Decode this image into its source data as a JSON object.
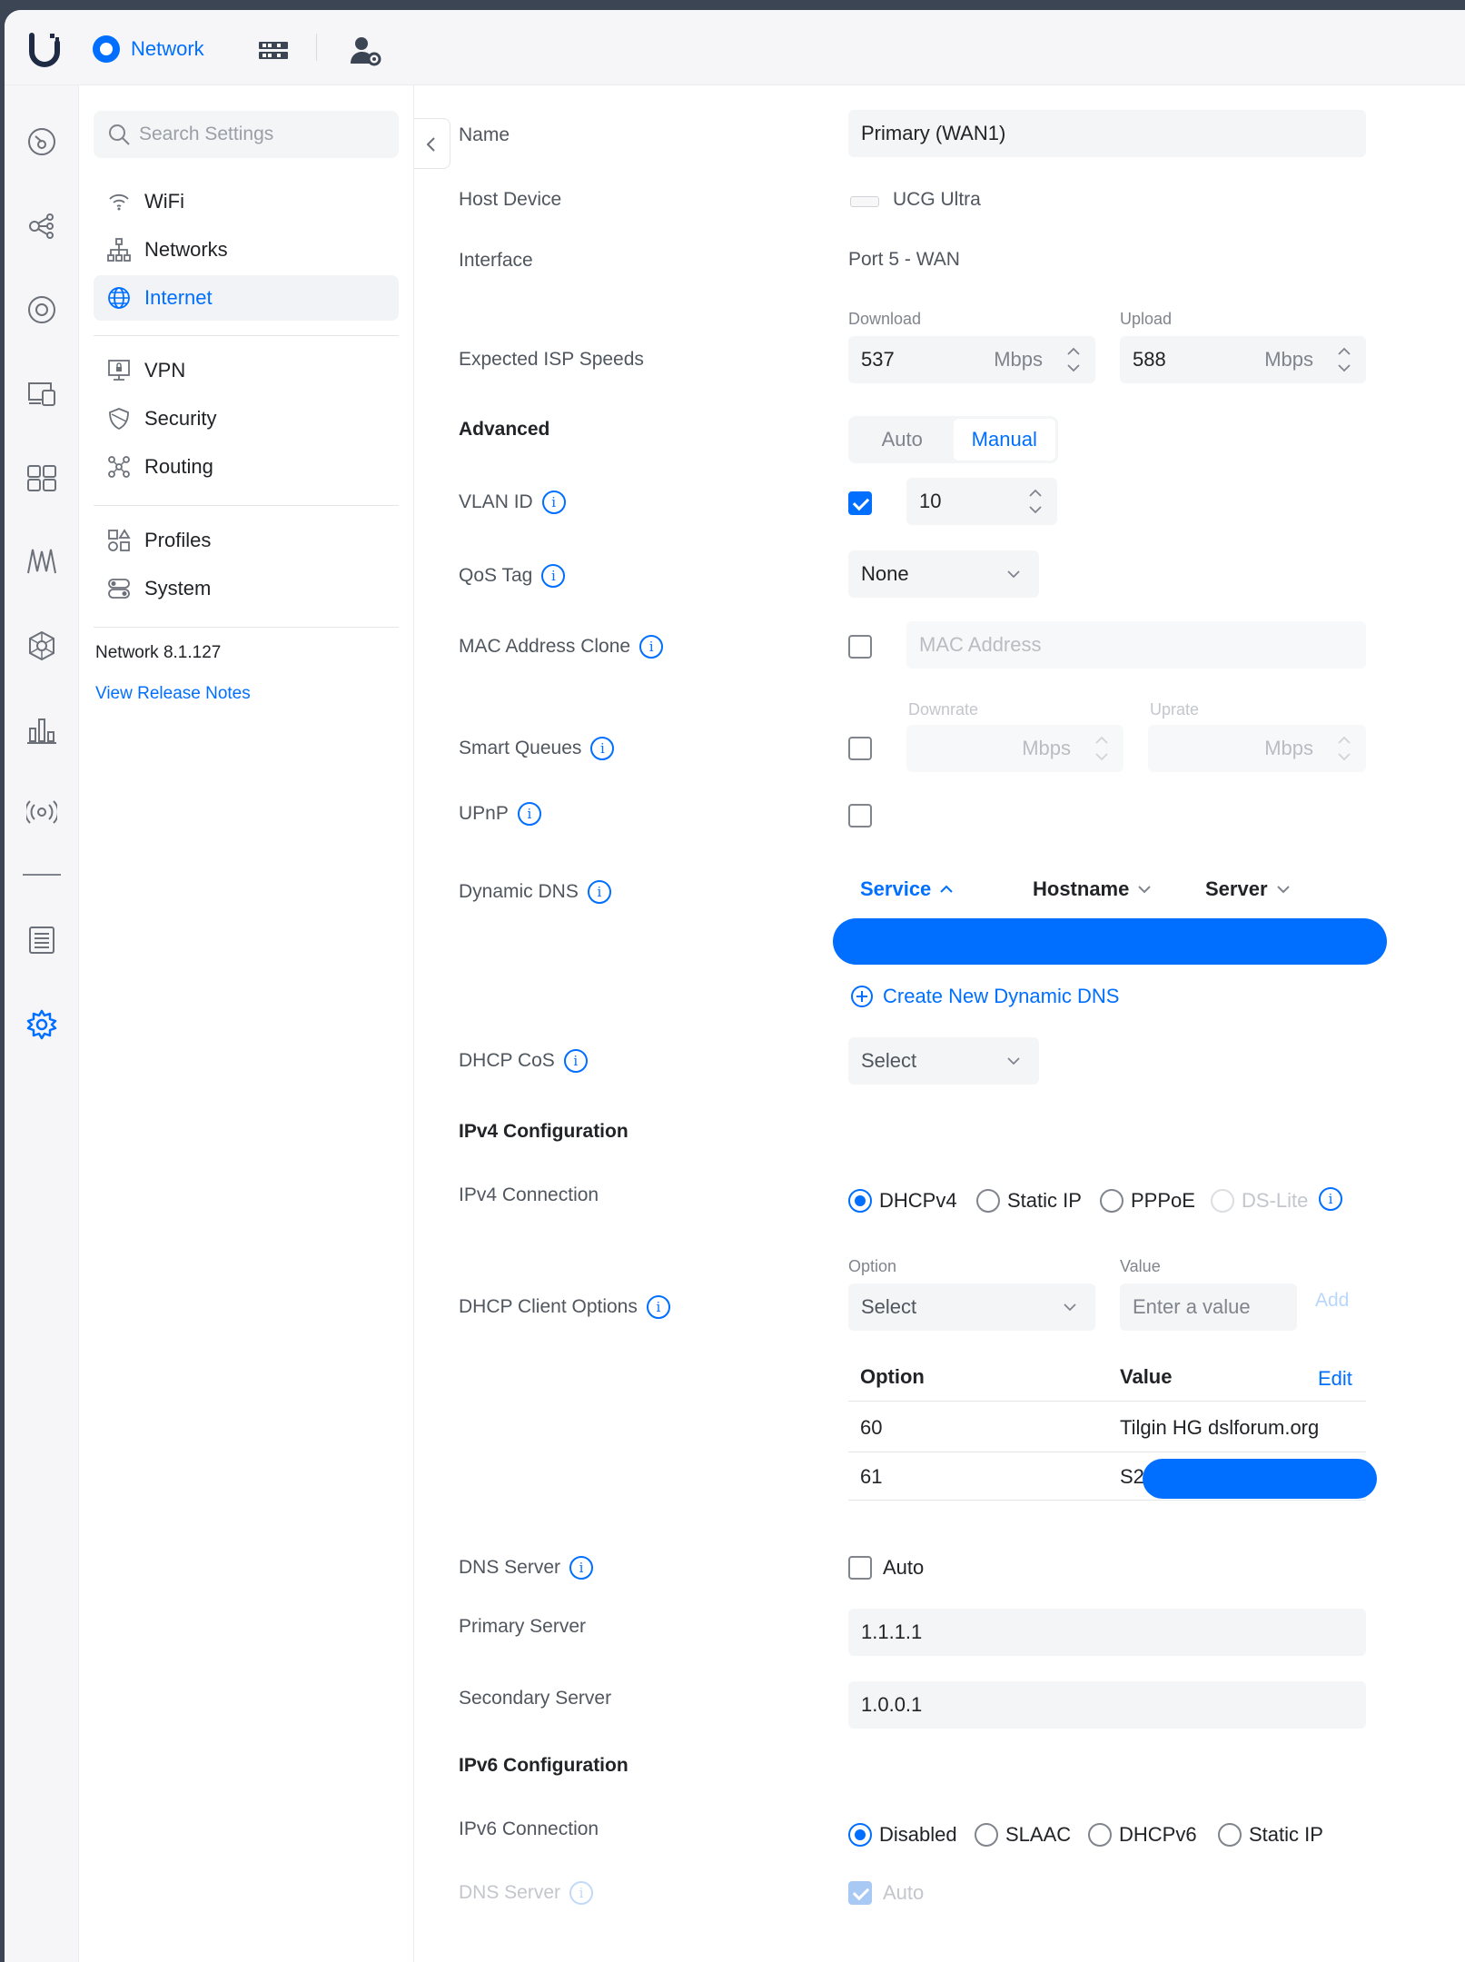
{
  "topbar": {
    "app_name": "Network",
    "icons": [
      "ubiquiti-logo-icon",
      "network-app-icon",
      "dashboard-grid-icon",
      "user-settings-icon"
    ]
  },
  "rail": {
    "icons": [
      "dashboard-icon",
      "topology-icon",
      "ubiquiti-devices-icon",
      "client-devices-icon",
      "ports-icon",
      "insights-icon",
      "integrations-icon",
      "statistics-icon",
      "radio-icon",
      "logs-icon",
      "settings-icon"
    ]
  },
  "nav": {
    "search_placeholder": "Search Settings",
    "items": [
      {
        "label": "WiFi",
        "icon": "wifi-icon"
      },
      {
        "label": "Networks",
        "icon": "networks-icon"
      },
      {
        "label": "Internet",
        "icon": "globe-icon",
        "active": true
      },
      {
        "label": "VPN",
        "icon": "vpn-icon"
      },
      {
        "label": "Security",
        "icon": "shield-icon"
      },
      {
        "label": "Routing",
        "icon": "routing-icon"
      },
      {
        "label": "Profiles",
        "icon": "profiles-icon"
      },
      {
        "label": "System",
        "icon": "system-icon"
      }
    ],
    "version": "Network 8.1.127",
    "release_notes": "View Release Notes"
  },
  "form": {
    "name": {
      "label": "Name",
      "value": "Primary (WAN1)"
    },
    "host_device": {
      "label": "Host Device",
      "value": "UCG Ultra"
    },
    "interface": {
      "label": "Interface",
      "value": "Port 5 - WAN"
    },
    "isp_speeds": {
      "label": "Expected ISP Speeds",
      "download_label": "Download",
      "download_value": "537",
      "upload_label": "Upload",
      "upload_value": "588",
      "unit": "Mbps"
    },
    "advanced": {
      "label": "Advanced",
      "options": [
        "Auto",
        "Manual"
      ],
      "selected": "Manual"
    },
    "vlan_id": {
      "label": "VLAN ID",
      "checked": true,
      "value": "10"
    },
    "qos_tag": {
      "label": "QoS Tag",
      "value": "None"
    },
    "mac_clone": {
      "label": "MAC Address Clone",
      "checked": false,
      "placeholder": "MAC Address"
    },
    "smart_queues": {
      "label": "Smart Queues",
      "checked": false,
      "downrate_label": "Downrate",
      "uprate_label": "Uprate",
      "unit": "Mbps"
    },
    "upnp": {
      "label": "UPnP",
      "checked": false
    },
    "dynamic_dns": {
      "label": "Dynamic DNS",
      "columns": [
        "Service",
        "Hostname",
        "Server"
      ],
      "create_label": "Create New Dynamic DNS"
    },
    "dhcp_cos": {
      "label": "DHCP CoS",
      "value": "Select"
    },
    "ipv4_heading": "IPv4 Configuration",
    "ipv4_connection": {
      "label": "IPv4 Connection",
      "options": [
        "DHCPv4",
        "Static IP",
        "PPPoE",
        "DS-Lite"
      ],
      "selected": "DHCPv4"
    },
    "dhcp_client_options": {
      "label": "DHCP Client Options",
      "option_label": "Option",
      "option_value": "Select",
      "value_label": "Value",
      "value_placeholder": "Enter a value",
      "add_label": "Add",
      "table_headers": [
        "Option",
        "Value"
      ],
      "edit_label": "Edit",
      "rows": [
        {
          "option": "60",
          "value": "Tilgin HG dslforum.org"
        },
        {
          "option": "61",
          "value": "S2"
        }
      ]
    },
    "dns_server": {
      "label": "DNS Server",
      "auto_label": "Auto",
      "checked": false
    },
    "primary_server": {
      "label": "Primary Server",
      "value": "1.1.1.1"
    },
    "secondary_server": {
      "label": "Secondary Server",
      "value": "1.0.0.1"
    },
    "ipv6_heading": "IPv6 Configuration",
    "ipv6_connection": {
      "label": "IPv6 Connection",
      "options": [
        "Disabled",
        "SLAAC",
        "DHCPv6",
        "Static IP"
      ],
      "selected": "Disabled"
    },
    "ipv6_dns_server": {
      "label": "DNS Server",
      "auto_label": "Auto",
      "checked": true
    }
  },
  "colors": {
    "accent": "#006fff",
    "background": "#ffffff",
    "sidebar": "#f6f6f8"
  }
}
